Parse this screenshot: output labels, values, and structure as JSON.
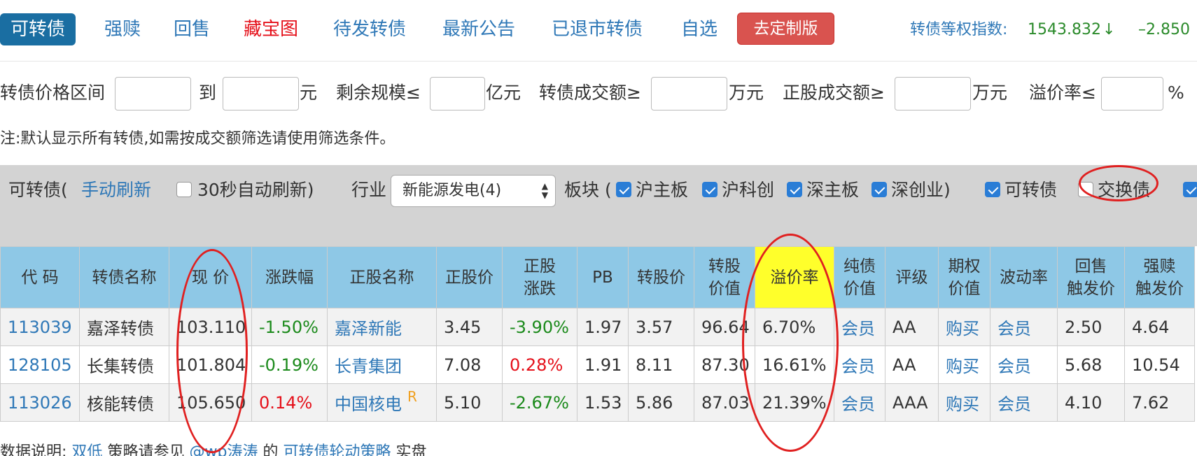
{
  "nav": {
    "tabs": [
      {
        "label": "可转债",
        "active": true
      },
      {
        "label": "强赎"
      },
      {
        "label": "回售"
      },
      {
        "label": "藏宝图",
        "color": "#e5101a"
      },
      {
        "label": "待发转债"
      },
      {
        "label": "最新公告"
      },
      {
        "label": "已退市转债"
      },
      {
        "label": "自选"
      }
    ],
    "custom_button": "去定制版",
    "index_label": "转债等权指数:",
    "index_value": "1543.832",
    "index_arrow": "↓",
    "index_change": "–2.850"
  },
  "filters": {
    "price_range_label": "转债价格区间",
    "to_label": "到",
    "yuan_label": "元",
    "remaining_scale_label": "剩余规模≤",
    "yi_yuan_label": "亿元",
    "bond_turnover_label": "转债成交额≥",
    "wan_yuan_label_1": "万元",
    "stock_turnover_label": "正股成交额≥",
    "wan_yuan_label_2": "万元",
    "premium_label": "溢价率≤",
    "percent_label": "%",
    "note": "注:默认显示所有转债,如需按成交额筛选请使用筛选条件。"
  },
  "toolbar": {
    "bond_prefix": "可转债(",
    "manual_refresh": "手动刷新",
    "auto_refresh": "30秒自动刷新)",
    "industry_label": "行业",
    "industry_selected": "新能源发电(4)",
    "board_label": "板块 (",
    "boards": [
      "沪主板",
      "沪科创",
      "深主板",
      "深创业)"
    ],
    "type_bond": "可转债",
    "type_exchange": "交换债"
  },
  "table": {
    "columns": [
      [
        "代 码"
      ],
      [
        "转债名称"
      ],
      [
        "现 价"
      ],
      [
        "涨跌幅"
      ],
      [
        "正股名称"
      ],
      [
        "正股价"
      ],
      [
        "正股",
        "涨跌"
      ],
      [
        "PB"
      ],
      [
        "转股价"
      ],
      [
        "转股",
        "价值"
      ],
      [
        "溢价率"
      ],
      [
        "纯债",
        "价值"
      ],
      [
        "评级"
      ],
      [
        "期权",
        "价值"
      ],
      [
        "波动率"
      ],
      [
        "回售",
        "触发价"
      ],
      [
        "强赎",
        "触发价"
      ]
    ],
    "rows": [
      {
        "code": "113039",
        "name": "嘉泽转债",
        "price": "103.110",
        "change": "-1.50%",
        "stock": "嘉泽新能",
        "badge": "",
        "stock_price": "3.45",
        "stock_change": "-3.90%",
        "pb": "1.97",
        "conv_price": "3.57",
        "conv_value": "96.64",
        "premium": "6.70%",
        "bond_value": "会员",
        "rating": "AA",
        "option": "购买",
        "vol": "会员",
        "put": "2.50",
        "call": "4.64"
      },
      {
        "code": "128105",
        "name": "长集转债",
        "price": "101.804",
        "change": "-0.19%",
        "stock": "长青集团",
        "badge": "",
        "stock_price": "7.08",
        "stock_change": "0.28%",
        "pb": "1.91",
        "conv_price": "8.11",
        "conv_value": "87.30",
        "premium": "16.61%",
        "bond_value": "会员",
        "rating": "AA",
        "option": "购买",
        "vol": "会员",
        "put": "5.68",
        "call": "10.54"
      },
      {
        "code": "113026",
        "name": "核能转债",
        "price": "105.650",
        "change": "0.14%",
        "stock": "中国核电",
        "badge": "R",
        "stock_price": "5.10",
        "stock_change": "-2.67%",
        "pb": "1.53",
        "conv_price": "5.86",
        "conv_value": "87.03",
        "premium": "21.39%",
        "bond_value": "会员",
        "rating": "AAA",
        "option": "购买",
        "vol": "会员",
        "put": "4.10",
        "call": "7.62"
      }
    ]
  },
  "footer": {
    "prefix": "数据说明:",
    "link1": "双低",
    "mid1": "策略请参见",
    "link2": "@wp涛涛",
    "mid2": "的",
    "link3": "可转债轮动策略",
    "suffix": "实盘"
  },
  "colors": {
    "accent": "#1a6ea2",
    "link": "#2f78b7",
    "down": "#1b8a1b",
    "up": "#e5101a",
    "header": "#8ec8e6",
    "highlight": "#ffff2b",
    "annotation": "#e02020"
  }
}
